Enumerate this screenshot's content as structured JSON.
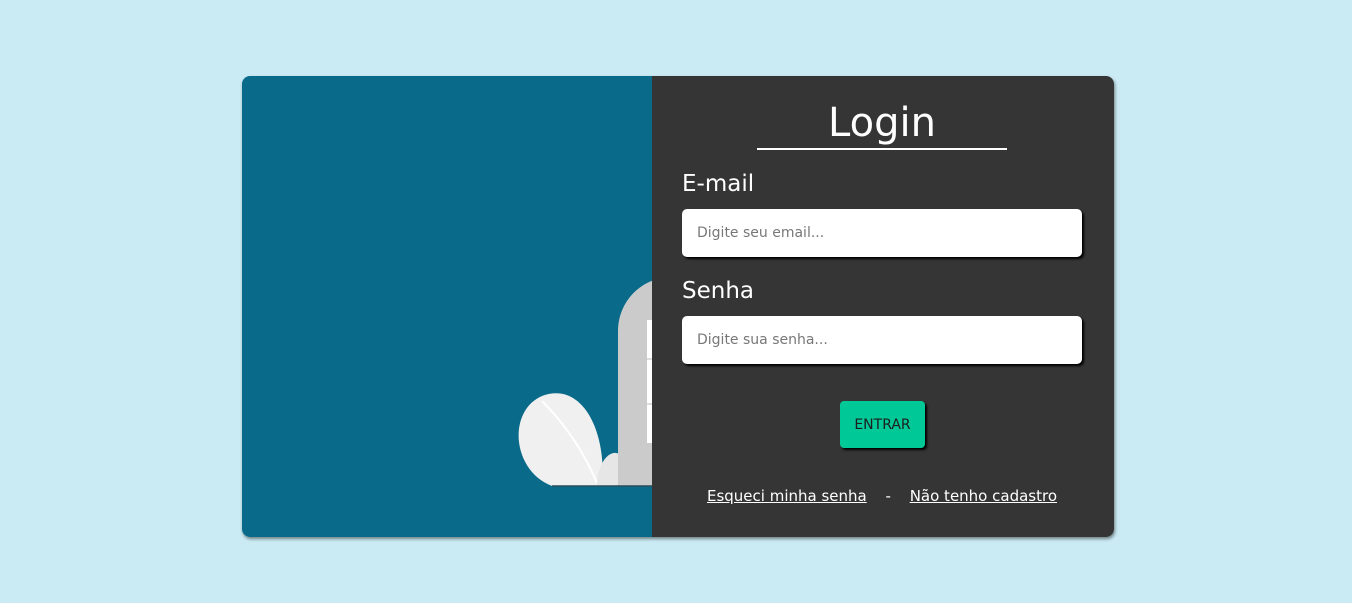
{
  "login": {
    "title": "Login",
    "email_label": "E-mail",
    "email_placeholder": "Digite seu email...",
    "password_label": "Senha",
    "password_placeholder": "Digite sua senha...",
    "submit_label": "ENTRAR",
    "forgot_password_link": "Esqueci minha senha",
    "separator": "-",
    "register_link": "Não tenho cadastro"
  },
  "colors": {
    "background": "#cbebf4",
    "left_panel": "#096a8a",
    "right_panel": "#353535",
    "submit_button": "#00c896"
  },
  "illustration": {
    "icon": "person-at-door-illustration"
  }
}
